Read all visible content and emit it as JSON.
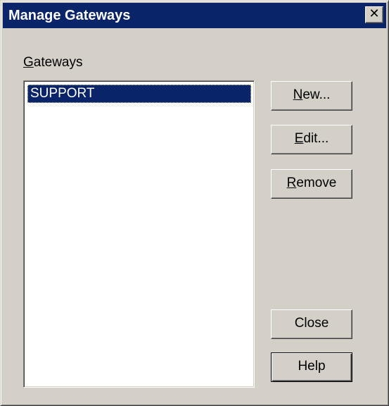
{
  "window": {
    "title": "Manage Gateways",
    "close_glyph": "✕"
  },
  "gateways": {
    "label_underlined": "G",
    "label_rest": "ateways",
    "items": [
      "SUPPORT"
    ],
    "selected_index": 0
  },
  "buttons": {
    "new": {
      "underlined": "N",
      "rest": "ew..."
    },
    "edit": {
      "underlined": "E",
      "rest": "dit..."
    },
    "remove": {
      "underlined": "R",
      "rest": "emove"
    },
    "close": {
      "label": "Close"
    },
    "help": {
      "label": "Help"
    }
  },
  "colors": {
    "titlebar": "#0a246a",
    "face": "#d4d0c8",
    "selection": "#0a246a"
  }
}
